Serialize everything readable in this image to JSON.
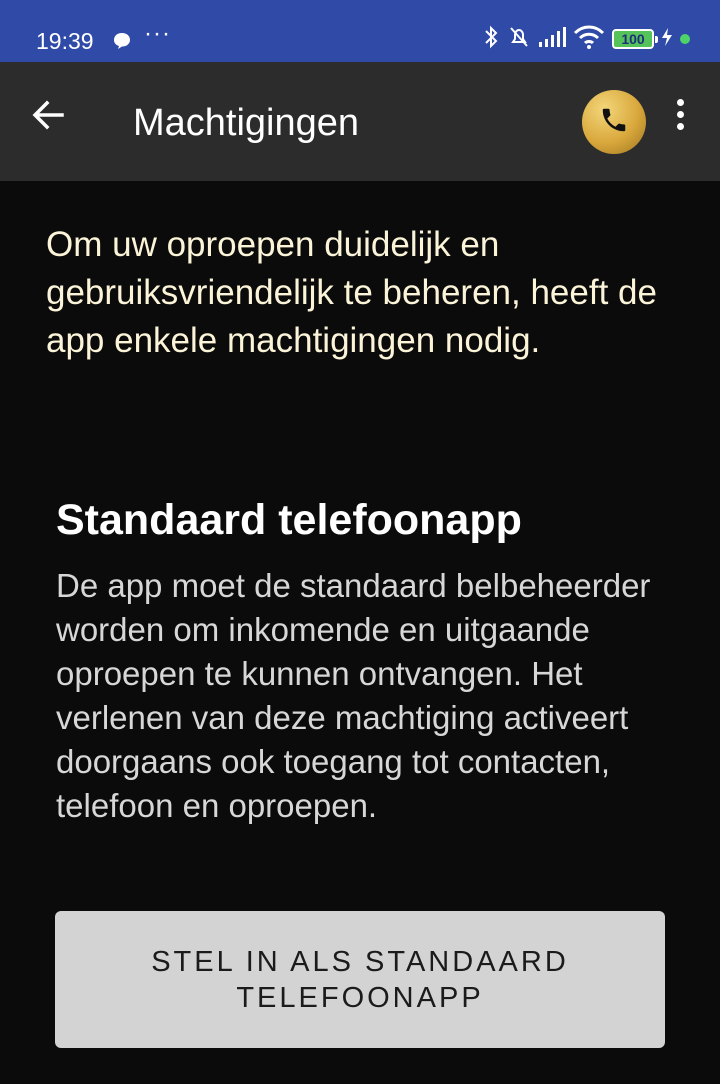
{
  "status_bar": {
    "time": "19:39",
    "more_indicator": "···",
    "battery_level": "100"
  },
  "app_bar": {
    "title": "Machtigingen",
    "back_icon": "arrow-left-icon",
    "avatar_icon": "phone-icon",
    "menu_icon": "vertical-dots-icon"
  },
  "main": {
    "intro": "Om uw oproepen duidelijk en gebruiksvriendelijk te beheren, heeft de app enkele machtigingen nodig.",
    "section_title": "Standaard telefoonapp",
    "section_body": "De app moet de standaard belbeheerder worden om inkomende en uitgaande oproepen te kunnen ontvangen. Het verlenen van deze machtiging activeert doorgaans ook toegang tot contacten, telefoon en oproepen.",
    "button_label": "STEL IN ALS STANDAARD TELEFOONAPP"
  },
  "colors": {
    "status_bar": "#2f4aa7",
    "app_bar": "#2c2c2c",
    "background": "#0b0b0b",
    "button": "#d3d3d3",
    "avatar_gold": "#d9a83c"
  }
}
